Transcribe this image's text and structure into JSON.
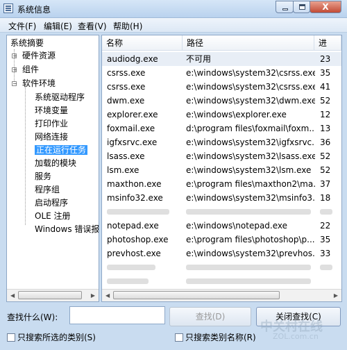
{
  "window": {
    "title": "系统信息",
    "close_label": "X"
  },
  "menu": [
    {
      "label": "文件(F)"
    },
    {
      "label": "编辑(E)"
    },
    {
      "label": "查看(V)"
    },
    {
      "label": "帮助(H)"
    }
  ],
  "tree": {
    "root": "系统摘要",
    "hardware": "硬件资源",
    "components": "组件",
    "software": "软件环境",
    "children": [
      "系统驱动程序",
      "环境变量",
      "打印作业",
      "网络连接",
      "正在运行任务",
      "加载的模块",
      "服务",
      "程序组",
      "启动程序",
      "OLE 注册",
      "Windows 错误报"
    ],
    "selected": "正在运行任务"
  },
  "table": {
    "columns": [
      "名称",
      "路径",
      "进"
    ],
    "rows": [
      {
        "name": "audiodg.exe",
        "path": "不可用",
        "num": "23"
      },
      {
        "name": "csrss.exe",
        "path": "e:\\windows\\system32\\csrss.exe",
        "num": "35"
      },
      {
        "name": "csrss.exe",
        "path": "e:\\windows\\system32\\csrss.exe",
        "num": "41"
      },
      {
        "name": "dwm.exe",
        "path": "e:\\windows\\system32\\dwm.exe",
        "num": "52"
      },
      {
        "name": "explorer.exe",
        "path": "e:\\windows\\explorer.exe",
        "num": "12"
      },
      {
        "name": "foxmail.exe",
        "path": "d:\\program files\\foxmail\\foxm...",
        "num": "13"
      },
      {
        "name": "igfxsrvc.exe",
        "path": "e:\\windows\\system32\\igfxsrvc....",
        "num": "36"
      },
      {
        "name": "lsass.exe",
        "path": "e:\\windows\\system32\\lsass.exe",
        "num": "52"
      },
      {
        "name": "lsm.exe",
        "path": "e:\\windows\\system32\\lsm.exe",
        "num": "52"
      },
      {
        "name": "maxthon.exe",
        "path": "e:\\program files\\maxthon2\\ma...",
        "num": "37"
      },
      {
        "name": "msinfo32.exe",
        "path": "e:\\windows\\system32\\msinfo3...",
        "num": "18"
      },
      {
        "name": "",
        "path": "",
        "num": ""
      },
      {
        "name": "notepad.exe",
        "path": "e:\\windows\\notepad.exe",
        "num": "22"
      },
      {
        "name": "photoshop.exe",
        "path": "e:\\program files\\photoshop\\p...",
        "num": "35"
      },
      {
        "name": "prevhost.exe",
        "path": "e:\\windows\\system32\\prevhos...",
        "num": "33"
      }
    ]
  },
  "find": {
    "label": "查找什么(W):",
    "value": "",
    "find_button": "查找(D)",
    "close_button": "关闭查找(C)",
    "chk_selected": "只搜索所选的类别(S)",
    "chk_names": "只搜索类别名称(R)"
  },
  "watermark": {
    "main": "中关村在线",
    "sub": "ZOL.com.cn"
  }
}
